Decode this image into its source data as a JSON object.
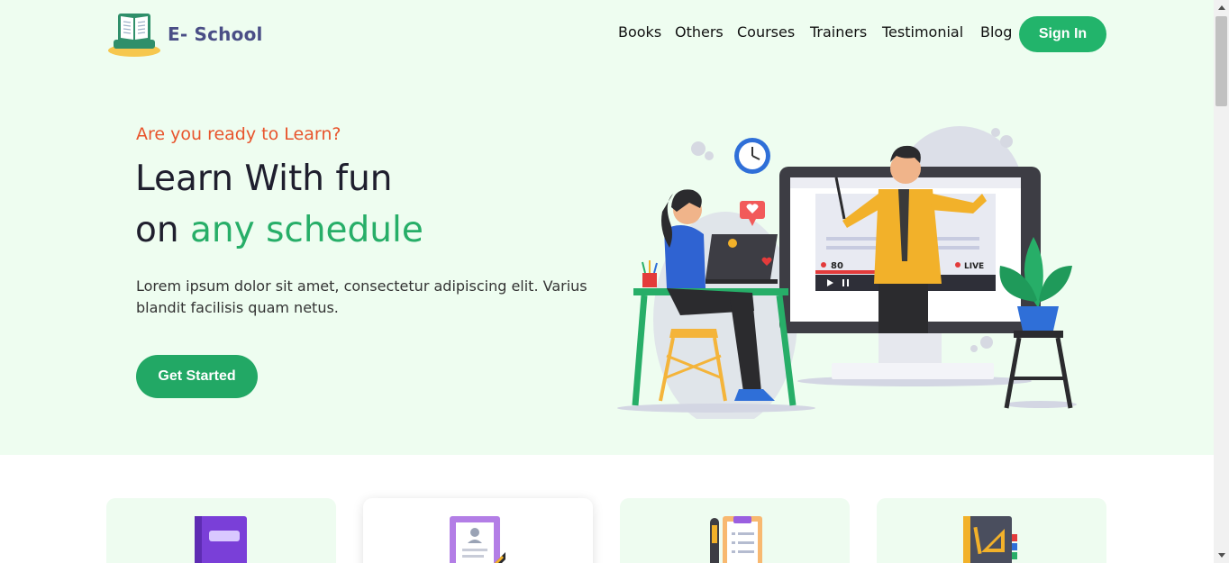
{
  "header": {
    "brand": "E- School",
    "logo_icon": "book-logo-icon",
    "nav": [
      "Books",
      "Others",
      "Courses",
      "Trainers",
      "Testimonial",
      "Blog"
    ],
    "signin_label": "Sign In"
  },
  "hero": {
    "tagline": "Are you ready to Learn?",
    "headline_line1": "Learn With fun",
    "headline_line2_prefix": "on ",
    "headline_line2_accent": "any schedule",
    "description": "Lorem ipsum dolor sit amet, consectetur adipiscing elit. Varius blandit facilisis quam netus.",
    "cta_label": "Get Started",
    "illustration": {
      "name": "online-teaching-illustration",
      "viewer_count": "80",
      "live_label": "LIVE"
    }
  },
  "cards": [
    {
      "icon": "book-icon"
    },
    {
      "icon": "certificate-icon"
    },
    {
      "icon": "clipboard-icon"
    },
    {
      "icon": "notebook-icon"
    }
  ],
  "colors": {
    "hero_bg": "#eefdf0",
    "primary_green": "#22b46b",
    "accent_orange": "#e8542c",
    "brand_purple": "#4a4e86"
  }
}
